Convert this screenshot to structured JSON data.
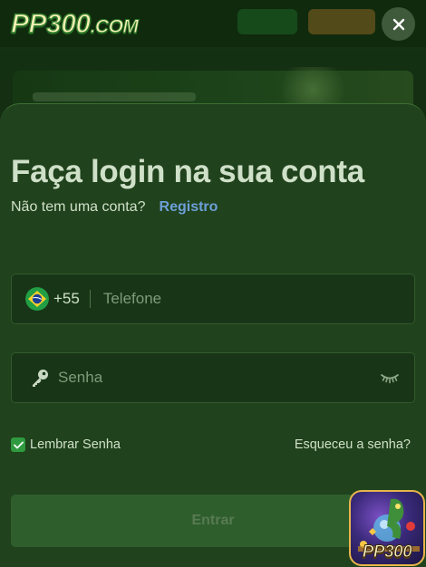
{
  "app": {
    "logo_main": "PP300",
    "logo_suffix": ".COM",
    "close_label": "×"
  },
  "login": {
    "title": "Faça login na sua conta",
    "no_account_text": "Não tem uma conta?",
    "register_link": "Registro",
    "phone": {
      "country_code": "+55",
      "placeholder": "Telefone",
      "value": ""
    },
    "password": {
      "placeholder": "Senha",
      "value": ""
    },
    "remember_label": "Lembrar Senha",
    "remember_checked": true,
    "forgot_link": "Esqueceu a senha?",
    "submit_label": "Entrar"
  },
  "badge": {
    "label": "PP300"
  },
  "colors": {
    "modal_bg": "#20421c",
    "input_bg": "#183617",
    "link": "#6c9fd8",
    "check": "#2f9a3f",
    "submit_bg": "#2e5e2c"
  },
  "icons": [
    "brazil-flag-icon",
    "key-icon",
    "eye-closed-icon",
    "check-icon",
    "close-icon"
  ]
}
